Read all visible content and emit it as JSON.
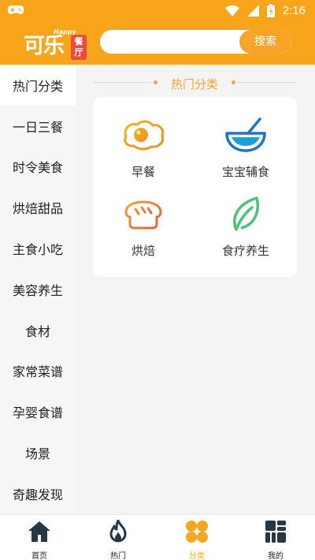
{
  "status_bar": {
    "time": "2:16"
  },
  "header": {
    "logo": {
      "main": "可乐",
      "happy": "Happy",
      "sub": "餐厅"
    },
    "search": {
      "value": "",
      "placeholder": "",
      "button_label": "搜索"
    }
  },
  "sidebar": {
    "items": [
      {
        "label": "热门分类",
        "active": true
      },
      {
        "label": "一日三餐"
      },
      {
        "label": "时令美食"
      },
      {
        "label": "烘焙甜品"
      },
      {
        "label": "主食小吃"
      },
      {
        "label": "美容养生"
      },
      {
        "label": "食材"
      },
      {
        "label": "家常菜谱"
      },
      {
        "label": "孕婴食谱"
      },
      {
        "label": "场景"
      },
      {
        "label": "奇趣发现"
      }
    ]
  },
  "main": {
    "section_title": "热门分类",
    "categories": [
      {
        "label": "早餐",
        "icon": "fried-egg-icon"
      },
      {
        "label": "宝宝辅食",
        "icon": "bowl-icon"
      },
      {
        "label": "烘焙",
        "icon": "bread-icon"
      },
      {
        "label": "食疗养生",
        "icon": "leaf-icon"
      }
    ]
  },
  "bottom_nav": {
    "tabs": [
      {
        "label": "首页",
        "icon": "home-icon"
      },
      {
        "label": "热门",
        "icon": "flame-icon"
      },
      {
        "label": "分类",
        "icon": "category-icon",
        "active": true
      },
      {
        "label": "我的",
        "icon": "grid-icon"
      }
    ]
  },
  "colors": {
    "brand": "#f9a51b",
    "accent": "#f5a623",
    "active_tab": "#f5a623"
  }
}
